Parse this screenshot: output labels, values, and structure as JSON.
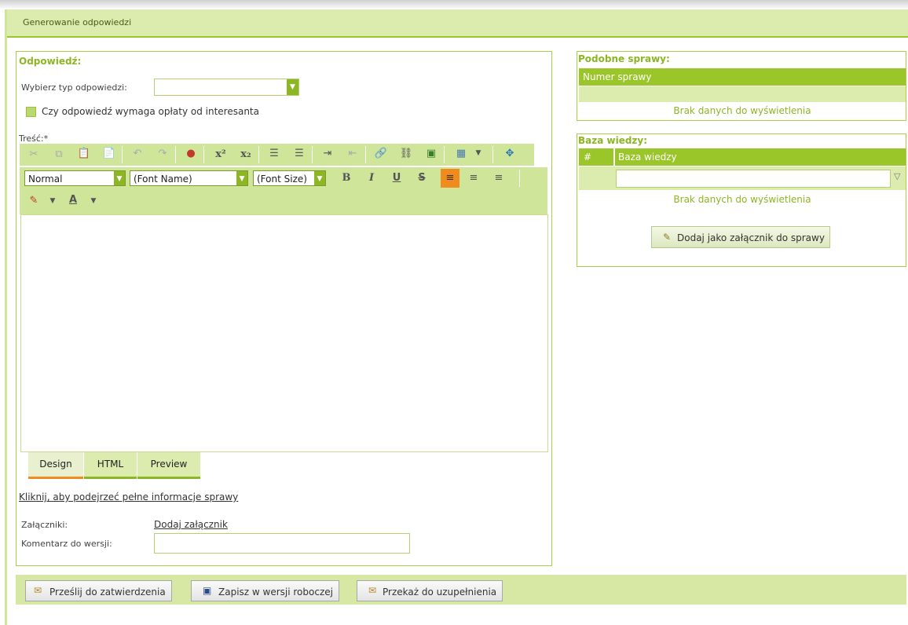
{
  "title": "Generowanie odpowiedzi",
  "answer": {
    "heading": "Odpowiedź:",
    "type_label": "Wybierz typ odpowiedzi:",
    "type_value": "",
    "fee_checkbox_label": "Czy odpowiedź wymaga opłaty od interesanta",
    "content_label": "Treść:*",
    "editor": {
      "style_value": "Normal",
      "font_name": "(Font Name)",
      "font_size": "(Font Size)",
      "tabs": [
        "Design",
        "HTML",
        "Preview"
      ],
      "active_tab": "Design"
    },
    "details_link": "Kliknij, aby podejrzeć pełne informacje sprawy",
    "attachments_label": "Załączniki:",
    "add_attachment_link": "Dodaj załącznik",
    "comment_label": "Komentarz do wersji:",
    "comment_value": ""
  },
  "similar": {
    "heading": "Podobne sprawy:",
    "column": "Numer sprawy",
    "empty": "Brak danych do wyświetlenia"
  },
  "knowledge": {
    "heading": "Baza wiedzy:",
    "col_hash": "#",
    "col_name": "Baza wiedzy",
    "filter_value": "",
    "empty": "Brak danych do wyświetlenia",
    "attach_button": "Dodaj jako załącznik do sprawy"
  },
  "footer": {
    "send_button": "Prześlij do zatwierdzenia",
    "save_button": "Zapisz w wersji roboczej",
    "forward_button": "Przekaż do uzupełnienia"
  },
  "colors": {
    "accent": "#9bc62a",
    "light": "#dcecae",
    "active_tab": "#f28b1d"
  }
}
